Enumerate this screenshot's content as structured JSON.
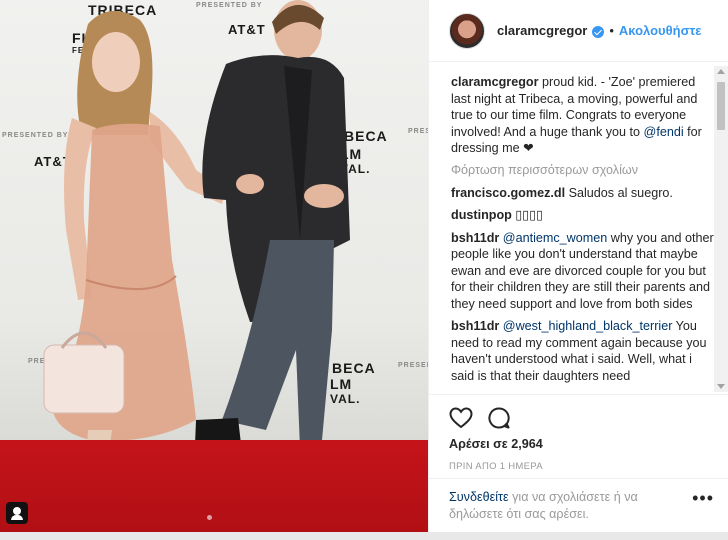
{
  "photo": {
    "backdrop_texts": [
      {
        "text": "TRIBECA",
        "style": "left:88px;top:2px;font-size:14px;"
      },
      {
        "text": "FILM",
        "style": "left:72px;top:30px;font-size:14px;"
      },
      {
        "text": "FESTIVAL",
        "style": "left:72px;top:46px;font-size:8px;"
      },
      {
        "text": "PRESENTED BY",
        "style": "left:196px;top:2px;font-size:7px;color:#888;"
      },
      {
        "text": "AT&T",
        "style": "left:228px;top:22px;font-size:13px;"
      },
      {
        "text": "PRESENTED BY",
        "style": "left:2px;top:132px;font-size:7px;color:#888;"
      },
      {
        "text": "AT&T",
        "style": "left:34px;top:154px;font-size:13px;"
      },
      {
        "text": "BECA",
        "style": "left:344px;top:128px;font-size:14px;"
      },
      {
        "text": "LM",
        "style": "left:340px;top:146px;font-size:14px;"
      },
      {
        "text": "VAL.",
        "style": "left:340px;top:162px;font-size:12px;"
      },
      {
        "text": "PRESEN",
        "style": "left:408px;top:128px;font-size:7px;color:#888;"
      },
      {
        "text": "BECA",
        "style": "left:332px;top:360px;font-size:14px;"
      },
      {
        "text": "LM",
        "style": "left:330px;top:376px;font-size:14px;"
      },
      {
        "text": "VAL.",
        "style": "left:330px;top:392px;font-size:12px;"
      },
      {
        "text": "PRESEN",
        "style": "left:398px;top:362px;font-size:7px;color:#888;"
      },
      {
        "text": "PRESEN",
        "style": "left:28px;top:358px;font-size:7px;color:#888;"
      }
    ]
  },
  "header": {
    "username": "claramcgregor",
    "separator": "•",
    "follow_label": "Ακολουθήστε"
  },
  "caption": {
    "username": "claramcgregor",
    "text_before": " proud kid. - 'Zoe' premiered last night at Tribeca, a moving, powerful and true to our time film. Congrats to everyone involved! And a huge thank you to ",
    "mention": "@fendi",
    "text_after": " for dressing me ❤"
  },
  "load_more_label": "Φόρτωση περισσότερων σχολίων",
  "comments": [
    {
      "user": "francisco.gomez.dl",
      "before": " Saludos al suegro.",
      "mention": "",
      "after": ""
    },
    {
      "user": "dustinpop",
      "before": " ▯▯▯▯",
      "mention": "",
      "after": ""
    },
    {
      "user": "bsh11dr",
      "before": " ",
      "mention": "@antiemc_women",
      "after": " why you and other people like you don't understand that maybe ewan and eve are divorced couple for you but for their children they are still their parents and they need support and love from both sides"
    },
    {
      "user": "bsh11dr",
      "before": " ",
      "mention": "@west_highland_black_terrier",
      "after": " You need to read my comment again because you haven't understood what i said. Well, what i said is that their daughters need"
    }
  ],
  "likes_label": "Αρέσει σε 2,964",
  "timestamp": "ΠΡΙΝ ΑΠΟ 1 ΗΜΕΡΑ",
  "comment_prompt": {
    "link": "Συνδεθείτε",
    "rest": " για να σχολιάσετε ή να δηλώσετε ότι σας αρέσει."
  },
  "more_label": "•••",
  "icons": {
    "like": "heart-icon",
    "comment": "comment-icon",
    "verified": "verified-badge-icon",
    "tags": "user-tag-icon"
  },
  "colors": {
    "accent": "#3897f0",
    "mention": "#003569",
    "carpet": "#c4141a"
  }
}
